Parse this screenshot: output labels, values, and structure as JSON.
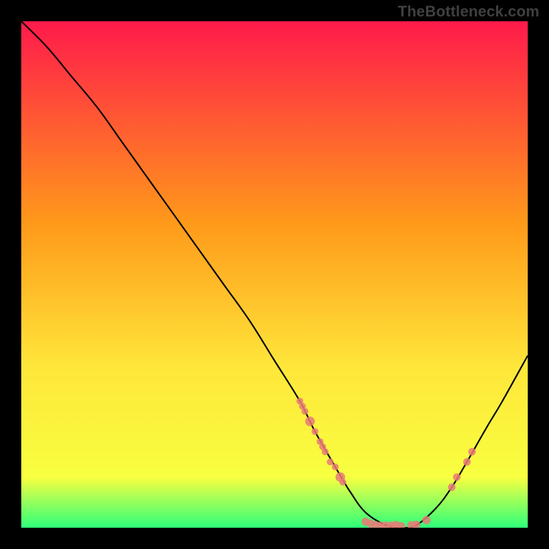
{
  "watermark": "TheBottleneck.com",
  "colors": {
    "gradient_top": "#ff1a4b",
    "gradient_mid1": "#ff9a1a",
    "gradient_mid2": "#ffe63a",
    "gradient_mid3": "#f8ff40",
    "gradient_bottom": "#2eff7a",
    "curve": "#000000",
    "marker": "#e97a78"
  },
  "chart_data": {
    "type": "line",
    "title": "",
    "xlabel": "",
    "ylabel": "",
    "xlim": [
      0,
      100
    ],
    "ylim": [
      0,
      100
    ],
    "series": [
      {
        "name": "curve",
        "x": [
          0,
          5,
          10,
          15,
          20,
          25,
          30,
          35,
          40,
          45,
          50,
          55,
          58,
          62,
          65,
          68,
          72,
          75,
          78,
          82,
          85,
          88,
          92,
          95,
          100
        ],
        "y": [
          100,
          95,
          89,
          83,
          76,
          69,
          62,
          55,
          48,
          41,
          33,
          25,
          19,
          12,
          7,
          3,
          0.5,
          0,
          0.5,
          4,
          8,
          13,
          20,
          25,
          34
        ]
      }
    ],
    "markers": [
      {
        "x": 55,
        "y": 25,
        "r": 1.0
      },
      {
        "x": 55.5,
        "y": 24,
        "r": 1.0
      },
      {
        "x": 56,
        "y": 23,
        "r": 1.0
      },
      {
        "x": 57,
        "y": 21,
        "r": 1.4
      },
      {
        "x": 58,
        "y": 19,
        "r": 1.0
      },
      {
        "x": 59,
        "y": 17,
        "r": 1.0
      },
      {
        "x": 59.5,
        "y": 16,
        "r": 1.0
      },
      {
        "x": 60,
        "y": 15,
        "r": 1.0
      },
      {
        "x": 61,
        "y": 13,
        "r": 1.0
      },
      {
        "x": 62,
        "y": 12,
        "r": 1.0
      },
      {
        "x": 63,
        "y": 10,
        "r": 1.4
      },
      {
        "x": 63.5,
        "y": 9,
        "r": 1.0
      },
      {
        "x": 68,
        "y": 1.2,
        "r": 1.2
      },
      {
        "x": 69,
        "y": 0.8,
        "r": 1.2
      },
      {
        "x": 70,
        "y": 0.5,
        "r": 1.2
      },
      {
        "x": 71,
        "y": 0.4,
        "r": 1.2
      },
      {
        "x": 72,
        "y": 0.4,
        "r": 1.2
      },
      {
        "x": 73,
        "y": 0.4,
        "r": 1.2
      },
      {
        "x": 74,
        "y": 0.4,
        "r": 1.4
      },
      {
        "x": 75,
        "y": 0.3,
        "r": 1.2
      },
      {
        "x": 77,
        "y": 0.5,
        "r": 1.2
      },
      {
        "x": 78,
        "y": 0.6,
        "r": 1.2
      },
      {
        "x": 80,
        "y": 1.5,
        "r": 1.2
      },
      {
        "x": 85,
        "y": 8,
        "r": 1.1
      },
      {
        "x": 86,
        "y": 10,
        "r": 1.1
      },
      {
        "x": 88,
        "y": 13,
        "r": 1.1
      },
      {
        "x": 89,
        "y": 15,
        "r": 1.1
      }
    ]
  }
}
